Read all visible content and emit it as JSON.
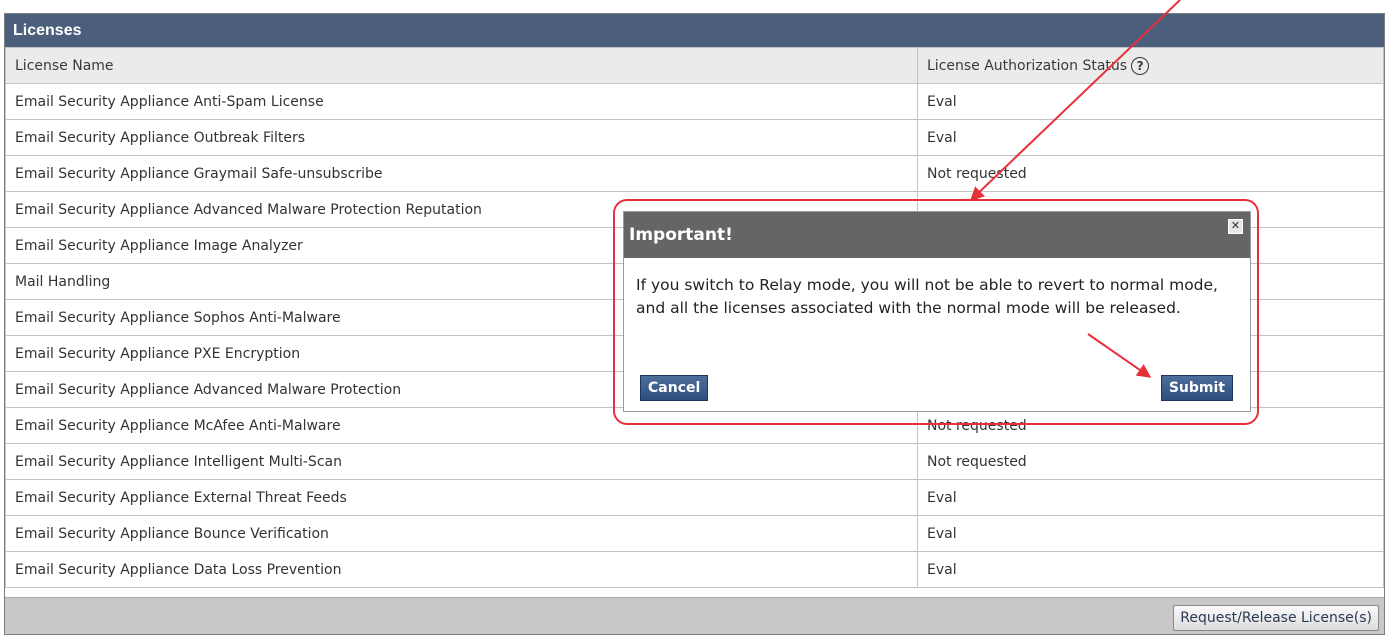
{
  "panel": {
    "title": "Licenses",
    "columns": [
      "License Name",
      "License Authorization Status"
    ],
    "help_icon_glyph": "?",
    "rows": [
      [
        "Email Security Appliance Anti-Spam License",
        "Eval"
      ],
      [
        "Email Security Appliance Outbreak Filters",
        "Eval"
      ],
      [
        "Email Security Appliance Graymail Safe-unsubscribe",
        "Not requested"
      ],
      [
        "Email Security Appliance Advanced Malware Protection Reputation",
        ""
      ],
      [
        "Email Security Appliance Image Analyzer",
        ""
      ],
      [
        "Mail Handling",
        ""
      ],
      [
        "Email Security Appliance Sophos Anti-Malware",
        ""
      ],
      [
        "Email Security Appliance PXE Encryption",
        ""
      ],
      [
        "Email Security Appliance Advanced Malware Protection",
        ""
      ],
      [
        "Email Security Appliance McAfee Anti-Malware",
        "Not requested"
      ],
      [
        "Email Security Appliance Intelligent Multi-Scan",
        "Not requested"
      ],
      [
        "Email Security Appliance External Threat Feeds",
        "Eval"
      ],
      [
        "Email Security Appliance Bounce Verification",
        "Eval"
      ],
      [
        "Email Security Appliance Data Loss Prevention",
        "Eval"
      ]
    ],
    "request_button": "Request/Release License(s)"
  },
  "dialog": {
    "title": "Important!",
    "message": "If you switch to Relay mode, you will not be able to revert to normal mode, and all the licenses associated with the normal mode will be released.",
    "cancel": "Cancel",
    "submit": "Submit",
    "close_icon": "close-icon"
  },
  "colors": {
    "header_bg": "#4b5f7c",
    "dialog_title_bg": "#656565",
    "button_blue": "#2d4f7e",
    "annotation_red": "#e8303a"
  }
}
